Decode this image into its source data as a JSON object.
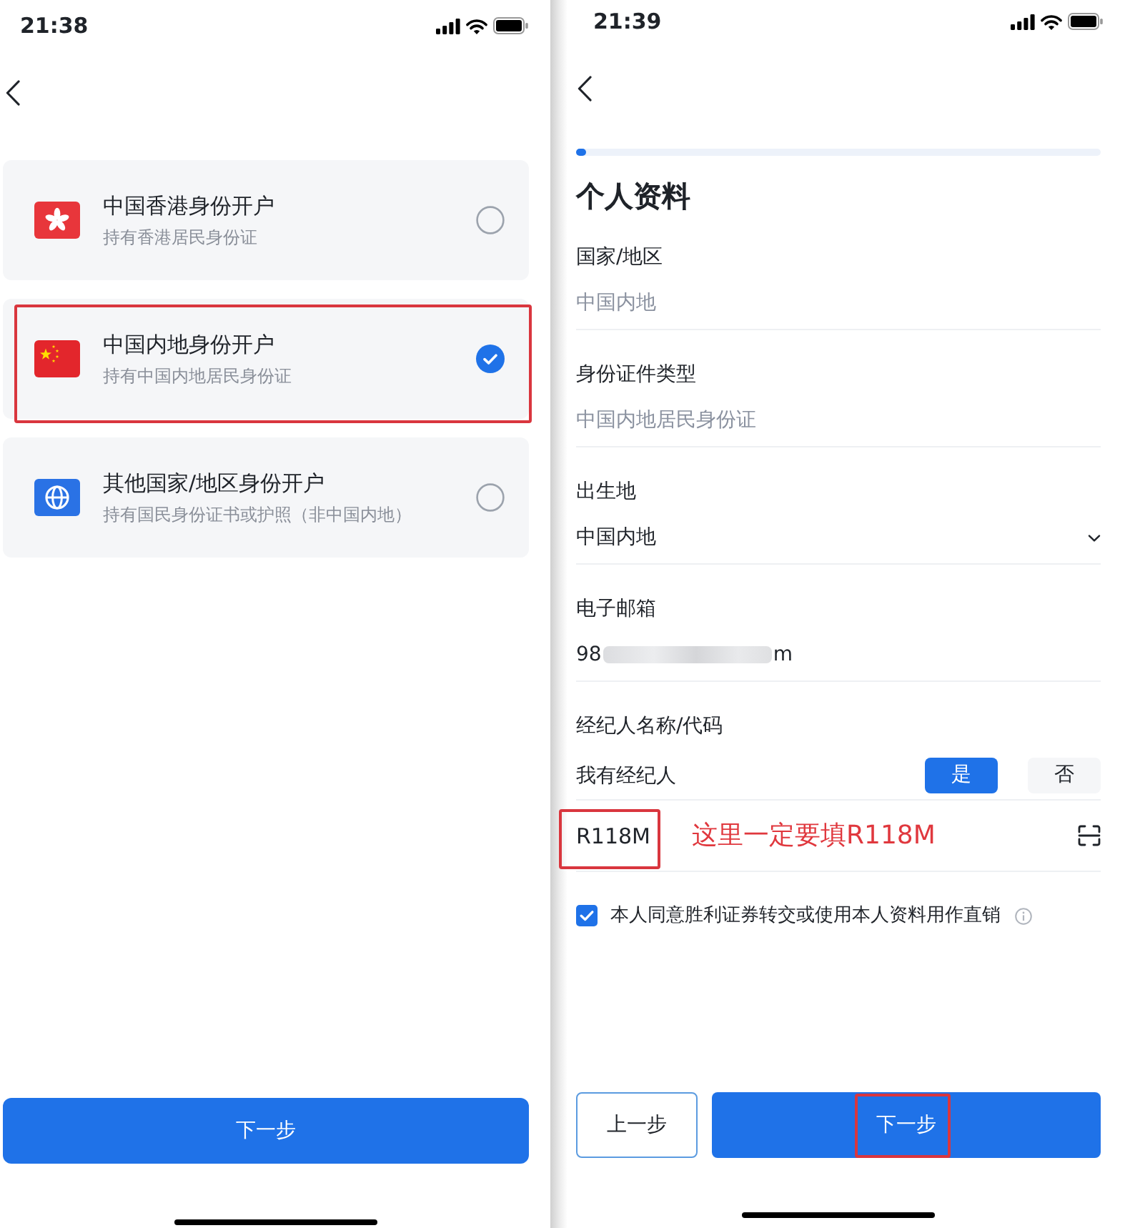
{
  "left_screen": {
    "status_bar": {
      "time": "21:38"
    },
    "options": [
      {
        "kind": "hong_kong",
        "title": "中国香港身份开户",
        "subtitle": "持有香港居民身份证",
        "selected": false,
        "annotated": false
      },
      {
        "kind": "mainland",
        "title": "中国内地身份开户",
        "subtitle": "持有中国内地居民身份证",
        "selected": true,
        "annotated": true
      },
      {
        "kind": "other",
        "title": "其他国家/地区身份开户",
        "subtitle": "持有国民身份证书或护照（非中国内地）",
        "selected": false,
        "annotated": false
      }
    ],
    "next_button": {
      "label": "下一步"
    }
  },
  "right_screen": {
    "status_bar": {
      "time": "21:39"
    },
    "progress": {
      "level": 0.02
    },
    "title": "个人资料",
    "fields": [
      {
        "kind": "static",
        "label": "国家/地区",
        "value": "中国内地"
      },
      {
        "kind": "static",
        "label": "身份证件类型",
        "value": "中国内地居民身份证"
      },
      {
        "kind": "select",
        "label": "出生地",
        "value": "中国内地"
      },
      {
        "kind": "email",
        "label": "电子邮箱",
        "value_start": "98",
        "value_end": "m",
        "redacted": true
      }
    ],
    "broker": {
      "label": "经纪人名称/代码",
      "question": "我有经纪人",
      "choices": [
        {
          "label": "是",
          "selected": true
        },
        {
          "label": "否",
          "selected": false
        }
      ],
      "code": {
        "value": "R118M",
        "annotated": true
      },
      "annotation": "这里一定要填R118M"
    },
    "consent": {
      "text": "本人同意胜利证券转交或使用本人资料用作直销",
      "checked": true
    },
    "buttons": [
      {
        "kind": "secondary",
        "label": "上一步",
        "annotated": false
      },
      {
        "kind": "primary",
        "label": "下一步",
        "annotated": true
      }
    ]
  }
}
